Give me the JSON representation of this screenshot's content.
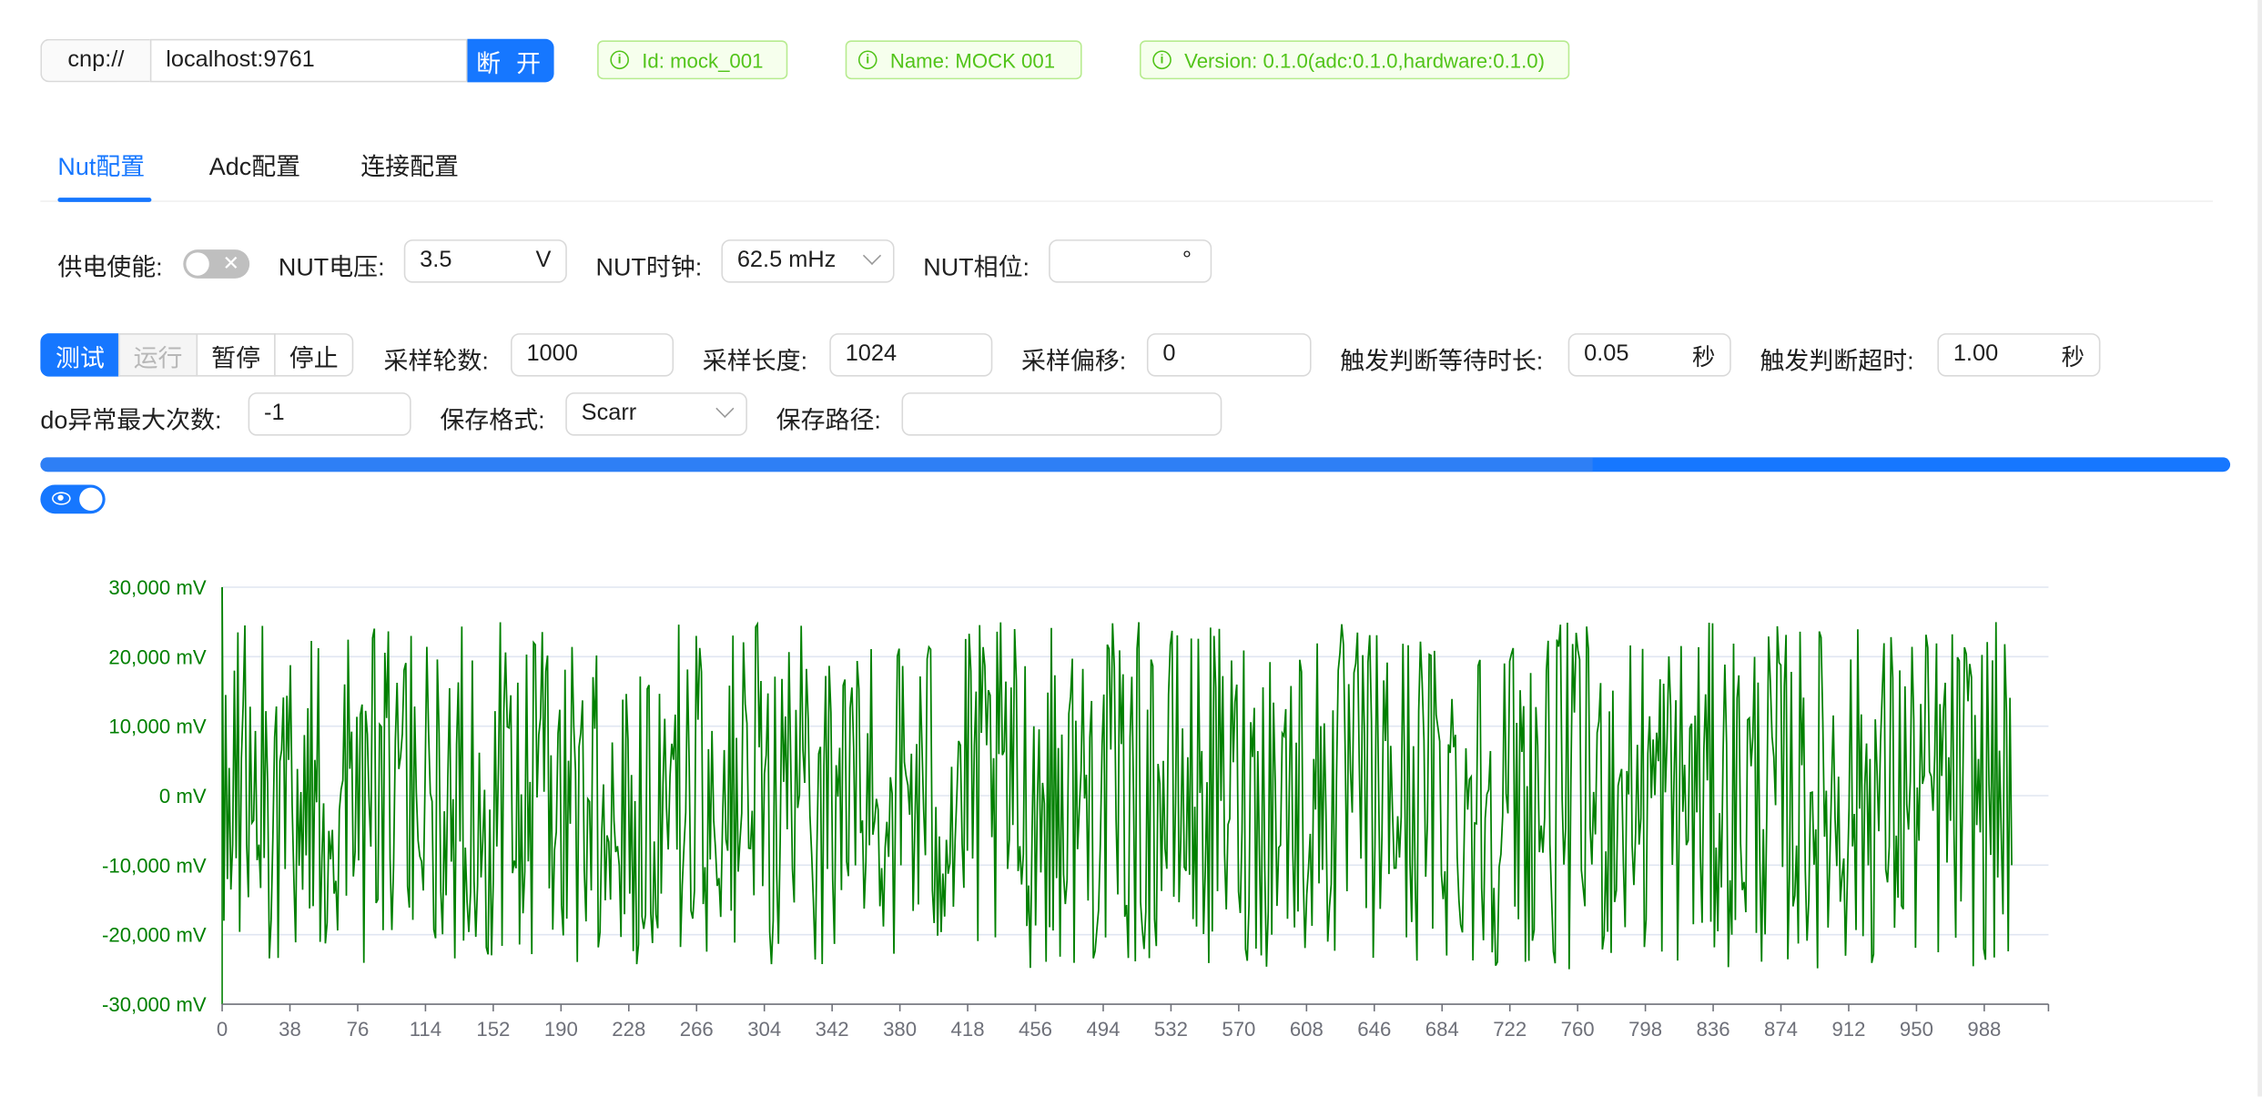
{
  "connection": {
    "protocol": "cnp://",
    "address": "localhost:9761",
    "disconnect_label": "断 开"
  },
  "tags": {
    "id": "Id: mock_001",
    "name": "Name: MOCK 001",
    "version": "Version: 0.1.0(adc:0.1.0,hardware:0.1.0)",
    "color": "#52c41a"
  },
  "tabs": [
    {
      "label": "Nut配置",
      "active": true
    },
    {
      "label": "Adc配置",
      "active": false
    },
    {
      "label": "连接配置",
      "active": false
    }
  ],
  "nut": {
    "power_label": "供电使能:",
    "power_on": false,
    "voltage_label": "NUT电压:",
    "voltage_value": "3.5",
    "voltage_unit": "V",
    "clock_label": "NUT时钟:",
    "clock_value": "62.5 mHz",
    "phase_label": "NUT相位:",
    "phase_value": "",
    "phase_unit": "°"
  },
  "controls": {
    "test_label": "测试",
    "run_label": "运行",
    "pause_label": "暂停",
    "stop_label": "停止",
    "rounds_label": "采样轮数:",
    "rounds_value": "1000",
    "length_label": "采样长度:",
    "length_value": "1024",
    "offset_label": "采样偏移:",
    "offset_value": "0",
    "wait_label": "触发判断等待时长:",
    "wait_value": "0.05",
    "wait_unit": "秒",
    "timeout_label": "触发判断超时:",
    "timeout_value": "1.00",
    "timeout_unit": "秒",
    "do_max_label": "do异常最大次数:",
    "do_max_value": "-1",
    "format_label": "保存格式:",
    "format_value": "Scarr",
    "path_label": "保存路径:",
    "path_value": ""
  },
  "progress": {
    "percent": 100,
    "accent": "#1677ff"
  },
  "chart_visible": true,
  "chart_data": {
    "type": "line",
    "color": "#008000",
    "ylim": [
      -30000,
      30000
    ],
    "yticks": [
      "30,000 mV",
      "20,000 mV",
      "10,000 mV",
      "0 mV",
      "-10,000 mV",
      "-20,000 mV",
      "-30,000 mV"
    ],
    "xticks": [
      "0",
      "38",
      "76",
      "114",
      "152",
      "190",
      "228",
      "266",
      "304",
      "342",
      "380",
      "418",
      "456",
      "494",
      "532",
      "570",
      "608",
      "646",
      "684",
      "722",
      "760",
      "798",
      "836",
      "874",
      "912",
      "950",
      "988"
    ],
    "xlim": [
      0,
      1024
    ],
    "sample_count": 1024,
    "amplitude_range": [
      -25000,
      25000
    ],
    "first_values": [
      30000,
      -18000,
      14500,
      -12000,
      4000,
      -13500,
      -7000,
      18000,
      -9000,
      23500
    ],
    "last_value": -10000,
    "grid": true
  }
}
